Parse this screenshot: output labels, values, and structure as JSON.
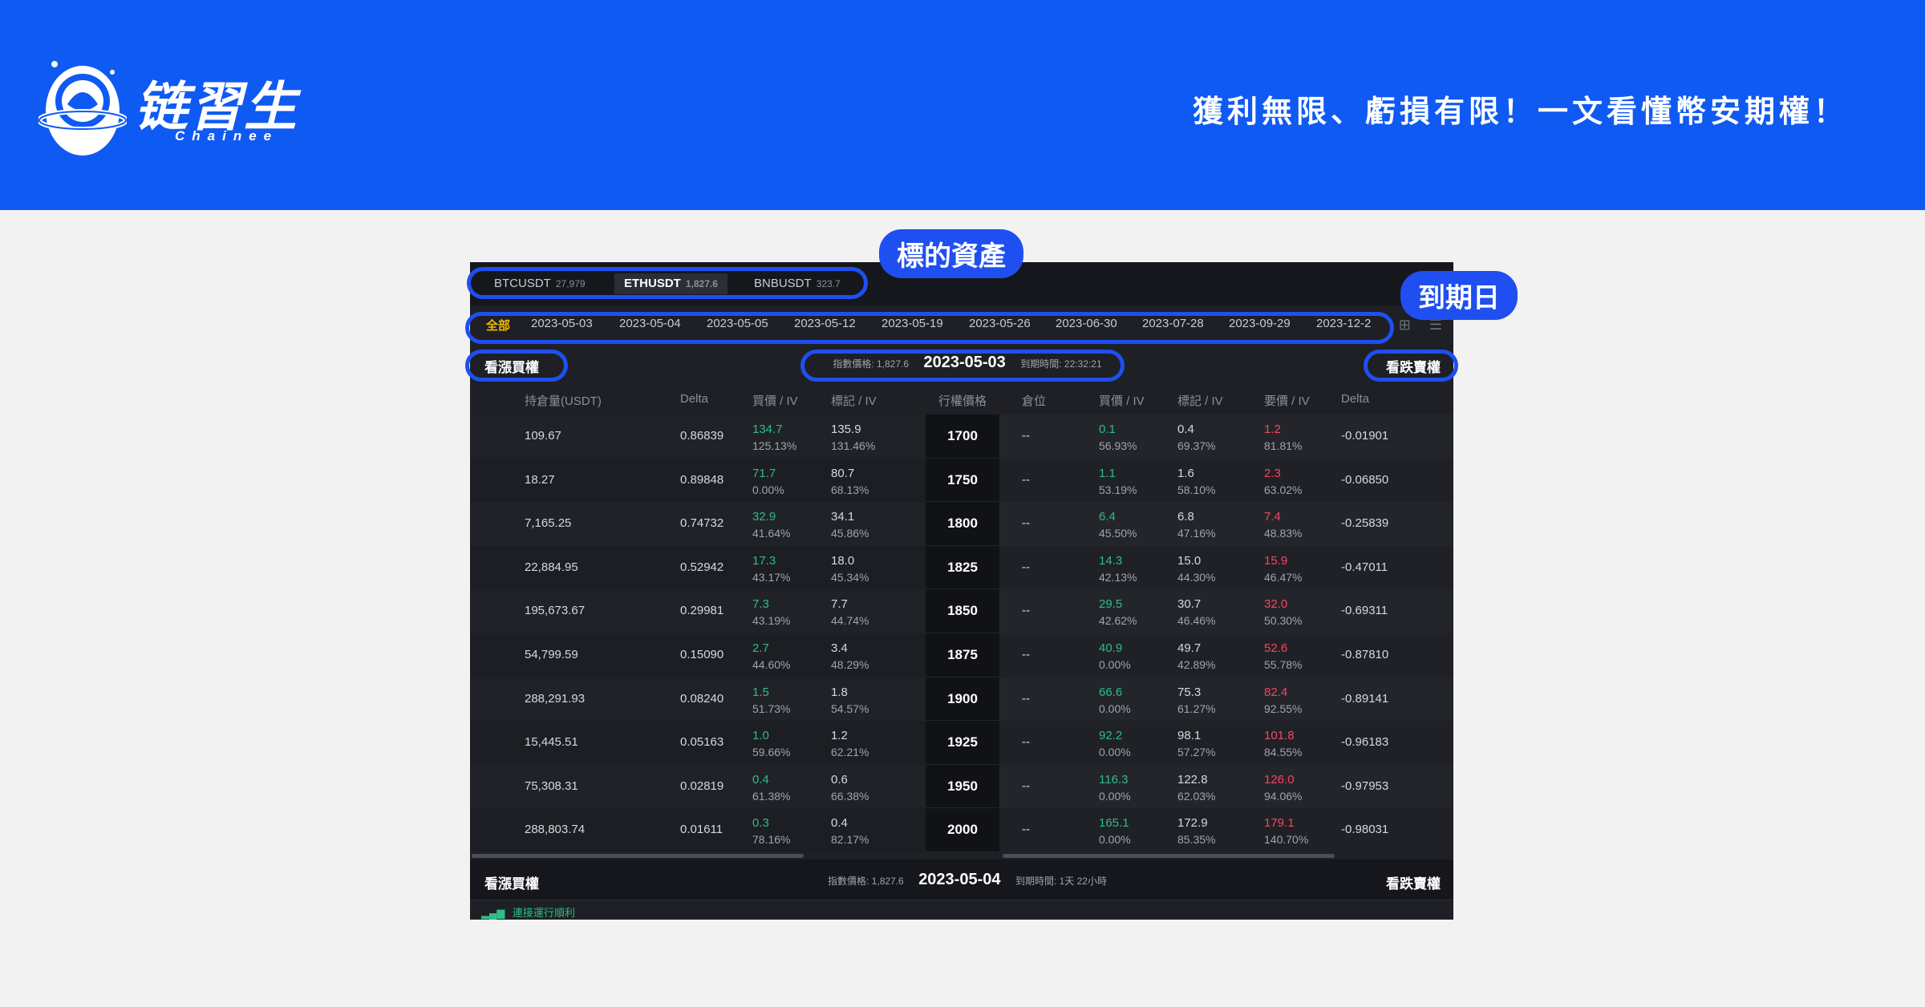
{
  "banner": {
    "logo_text": "链習生",
    "logo_sub": "Chainee",
    "tagline": "獲利無限、虧損有限！一文看懂幣安期權！",
    "color": "#0f5af2"
  },
  "assets": [
    {
      "symbol": "BTCUSDT",
      "price": "27,979"
    },
    {
      "symbol": "ETHUSDT",
      "price": "1,827.6"
    },
    {
      "symbol": "BNBUSDT",
      "price": "323.7"
    }
  ],
  "dates": [
    "全部",
    "2023-05-03",
    "2023-05-04",
    "2023-05-05",
    "2023-05-12",
    "2023-05-19",
    "2023-05-26",
    "2023-06-30",
    "2023-07-28",
    "2023-09-29",
    "2023-12-2"
  ],
  "section": {
    "call_label": "看漲買權",
    "put_label": "看跌賣權",
    "index_price": "指數價格: 1,827.6",
    "expiry_date": "2023-05-03",
    "time_left": "到期時間: 22:32:21"
  },
  "columns": {
    "position": "持倉量(USDT)",
    "delta": "Delta",
    "bid_iv": "買價 / IV",
    "mark_iv": "標記 / IV",
    "strike": "行權價格",
    "holding": "倉位",
    "put_bid_iv": "買價 / IV",
    "put_mark_iv": "標記 / IV",
    "ask_iv": "要價 / IV",
    "put_delta": "Delta"
  },
  "rows": [
    {
      "pos": "109.67",
      "delta": "0.86839",
      "bid": "134.7",
      "bid_iv": "125.13%",
      "mark": "135.9",
      "mark_iv": "131.46%",
      "strike": "1700",
      "holding": "--",
      "pbid": "0.1",
      "pbid_iv": "56.93%",
      "pmark": "0.4",
      "pmark_iv": "69.37%",
      "ask": "1.2",
      "ask_iv": "81.81%",
      "pdelta": "-0.01901"
    },
    {
      "pos": "18.27",
      "delta": "0.89848",
      "bid": "71.7",
      "bid_iv": "0.00%",
      "mark": "80.7",
      "mark_iv": "68.13%",
      "strike": "1750",
      "holding": "--",
      "pbid": "1.1",
      "pbid_iv": "53.19%",
      "pmark": "1.6",
      "pmark_iv": "58.10%",
      "ask": "2.3",
      "ask_iv": "63.02%",
      "pdelta": "-0.06850"
    },
    {
      "pos": "7,165.25",
      "delta": "0.74732",
      "bid": "32.9",
      "bid_iv": "41.64%",
      "mark": "34.1",
      "mark_iv": "45.86%",
      "strike": "1800",
      "holding": "--",
      "pbid": "6.4",
      "pbid_iv": "45.50%",
      "pmark": "6.8",
      "pmark_iv": "47.16%",
      "ask": "7.4",
      "ask_iv": "48.83%",
      "pdelta": "-0.25839"
    },
    {
      "pos": "22,884.95",
      "delta": "0.52942",
      "bid": "17.3",
      "bid_iv": "43.17%",
      "mark": "18.0",
      "mark_iv": "45.34%",
      "strike": "1825",
      "holding": "--",
      "pbid": "14.3",
      "pbid_iv": "42.13%",
      "pmark": "15.0",
      "pmark_iv": "44.30%",
      "ask": "15.9",
      "ask_iv": "46.47%",
      "pdelta": "-0.47011"
    },
    {
      "pos": "195,673.67",
      "delta": "0.29981",
      "bid": "7.3",
      "bid_iv": "43.19%",
      "mark": "7.7",
      "mark_iv": "44.74%",
      "strike": "1850",
      "holding": "--",
      "pbid": "29.5",
      "pbid_iv": "42.62%",
      "pmark": "30.7",
      "pmark_iv": "46.46%",
      "ask": "32.0",
      "ask_iv": "50.30%",
      "pdelta": "-0.69311"
    },
    {
      "pos": "54,799.59",
      "delta": "0.15090",
      "bid": "2.7",
      "bid_iv": "44.60%",
      "mark": "3.4",
      "mark_iv": "48.29%",
      "strike": "1875",
      "holding": "--",
      "pbid": "40.9",
      "pbid_iv": "0.00%",
      "pmark": "49.7",
      "pmark_iv": "42.89%",
      "ask": "52.6",
      "ask_iv": "55.78%",
      "pdelta": "-0.87810"
    },
    {
      "pos": "288,291.93",
      "delta": "0.08240",
      "bid": "1.5",
      "bid_iv": "51.73%",
      "mark": "1.8",
      "mark_iv": "54.57%",
      "strike": "1900",
      "holding": "--",
      "pbid": "66.6",
      "pbid_iv": "0.00%",
      "pmark": "75.3",
      "pmark_iv": "61.27%",
      "ask": "82.4",
      "ask_iv": "92.55%",
      "pdelta": "-0.89141"
    },
    {
      "pos": "15,445.51",
      "delta": "0.05163",
      "bid": "1.0",
      "bid_iv": "59.66%",
      "mark": "1.2",
      "mark_iv": "62.21%",
      "strike": "1925",
      "holding": "--",
      "pbid": "92.2",
      "pbid_iv": "0.00%",
      "pmark": "98.1",
      "pmark_iv": "57.27%",
      "ask": "101.8",
      "ask_iv": "84.55%",
      "pdelta": "-0.96183"
    },
    {
      "pos": "75,308.31",
      "delta": "0.02819",
      "bid": "0.4",
      "bid_iv": "61.38%",
      "mark": "0.6",
      "mark_iv": "66.38%",
      "strike": "1950",
      "holding": "--",
      "pbid": "116.3",
      "pbid_iv": "0.00%",
      "pmark": "122.8",
      "pmark_iv": "62.03%",
      "ask": "126.0",
      "ask_iv": "94.06%",
      "pdelta": "-0.97953"
    },
    {
      "pos": "288,803.74",
      "delta": "0.01611",
      "bid": "0.3",
      "bid_iv": "78.16%",
      "mark": "0.4",
      "mark_iv": "82.17%",
      "strike": "2000",
      "holding": "--",
      "pbid": "165.1",
      "pbid_iv": "0.00%",
      "pmark": "172.9",
      "pmark_iv": "85.35%",
      "ask": "179.1",
      "ask_iv": "140.70%",
      "pdelta": "-0.98031"
    }
  ],
  "footer": {
    "call_label": "看漲買權",
    "put_label": "看跌賣權",
    "index_price": "指數價格: 1,827.6",
    "expiry_date": "2023-05-04",
    "time_left": "到期時間: 1天 22小時"
  },
  "status": "連接運行順利",
  "annotations": {
    "asset_callout": "標的資產",
    "date_callout": "到期日",
    "color": "#1f4ff0"
  }
}
